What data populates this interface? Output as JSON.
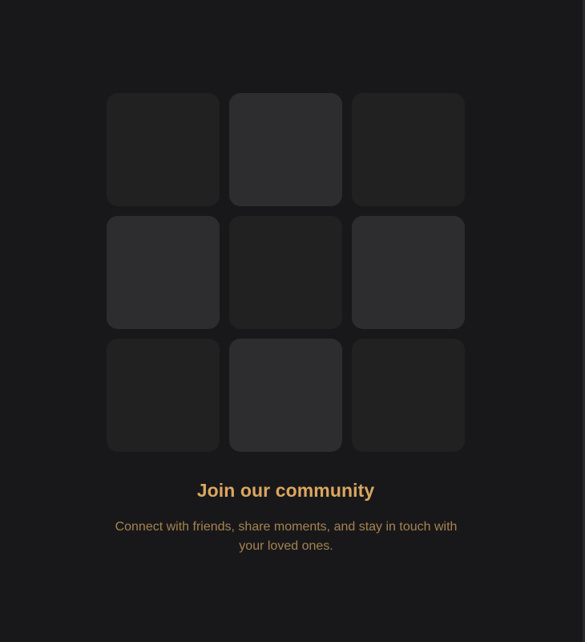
{
  "placeholder_grid": {
    "tiles": [
      {
        "shade": "dark"
      },
      {
        "shade": "light"
      },
      {
        "shade": "dark"
      },
      {
        "shade": "light"
      },
      {
        "shade": "dark"
      },
      {
        "shade": "light"
      },
      {
        "shade": "dark"
      },
      {
        "shade": "light"
      },
      {
        "shade": "dark"
      }
    ]
  },
  "content": {
    "title": "Join our community",
    "subtitle": "Connect with friends, share moments, and stay in touch with your loved ones."
  },
  "colors": {
    "background": "#18181a",
    "tile_dark": "#212121",
    "tile_light": "#2d2d2f",
    "title": "#dba660",
    "subtitle": "#a6834f"
  }
}
